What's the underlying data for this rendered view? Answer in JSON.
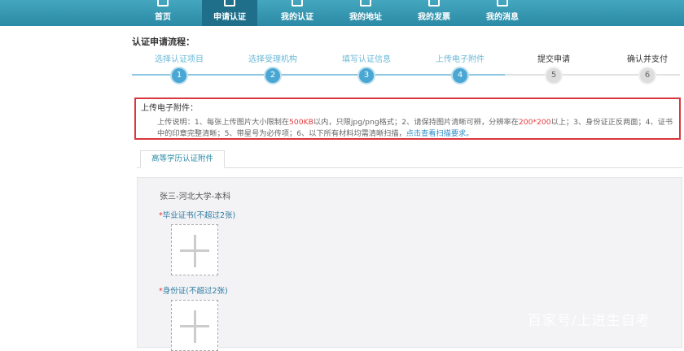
{
  "nav": {
    "items": [
      {
        "label": "首页"
      },
      {
        "label": "申请认证",
        "active": true
      },
      {
        "label": "我的认证"
      },
      {
        "label": "我的地址"
      },
      {
        "label": "我的发票"
      },
      {
        "label": "我的消息"
      }
    ]
  },
  "flow": {
    "title": "认证申请流程：",
    "steps": [
      {
        "num": "1",
        "label": "选择认证项目",
        "done": true
      },
      {
        "num": "2",
        "label": "选择受理机构",
        "done": true
      },
      {
        "num": "3",
        "label": "填写认证信息",
        "done": true
      },
      {
        "num": "4",
        "label": "上传电子附件",
        "done": true
      },
      {
        "num": "5",
        "label": "提交申请",
        "done": false
      },
      {
        "num": "6",
        "label": "确认并支付",
        "done": false
      }
    ]
  },
  "notice": {
    "title": "上传电子附件：",
    "p1": "上传说明：1、每张上传图片大小限制在",
    "size": "500KB",
    "p2": "以内，只限jpg/png格式；2、请保持图片清晰可辨，分辨率在",
    "res": "200*200",
    "p3": "以上；3、身份证正反两面；4、证书中的印章完整清晰；5、带星号为必传项；6、以下所有材料均需清晰扫描，",
    "link": "点击查看扫描要求。"
  },
  "tab": {
    "label": "高等学历认证附件"
  },
  "panel": {
    "owner": "张三-河北大学-本科",
    "fields": [
      {
        "star": "*",
        "label": "毕业证书(不超过2张)"
      },
      {
        "star": "*",
        "label": "身份证(不超过2张)"
      }
    ]
  },
  "watermark": "百家号/上进生自考",
  "colors": {
    "nav": "#2b8aa5",
    "accent": "#4aa6d2",
    "alert": "#d9363e"
  }
}
